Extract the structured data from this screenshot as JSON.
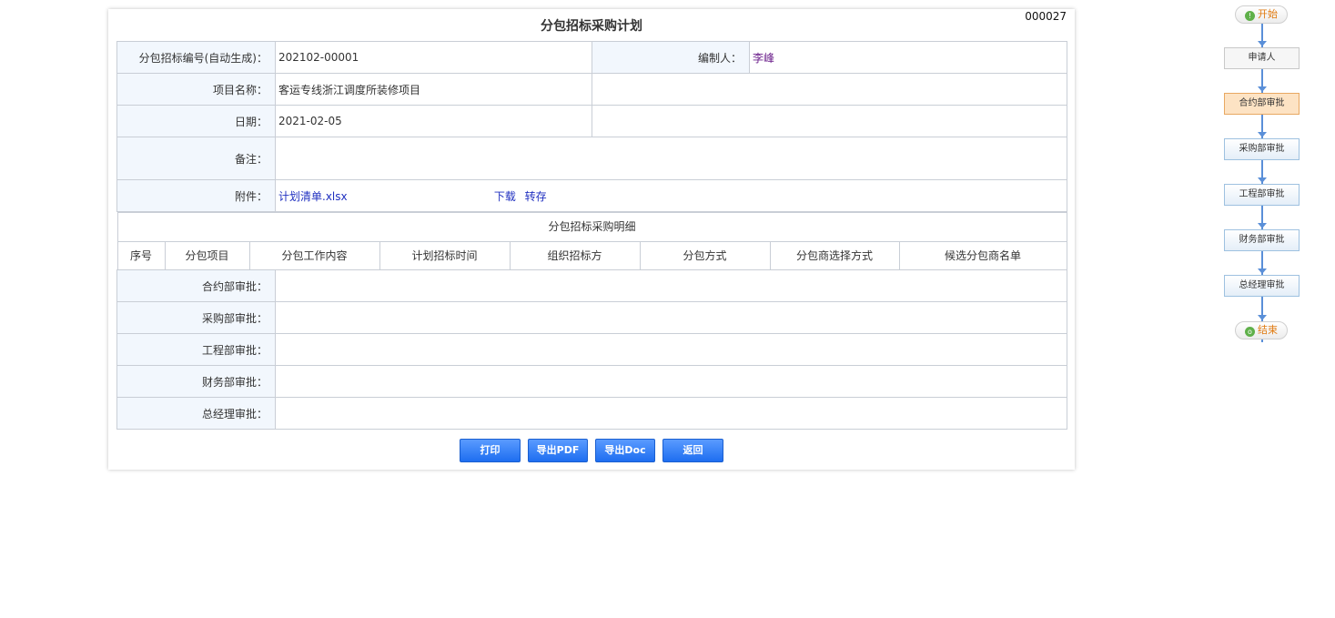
{
  "form": {
    "title": "分包招标采购计划",
    "doc_no": "000027",
    "rows": {
      "code": {
        "label": "分包招标编号(自动生成)：",
        "value": "202102-00001"
      },
      "editor": {
        "label": "编制人：",
        "value": "李峰"
      },
      "project": {
        "label": "项目名称：",
        "value": "客运专线浙江调度所装修项目"
      },
      "date": {
        "label": "日期：",
        "value": "2021-02-05"
      },
      "remark": {
        "label": "备注：",
        "value": ""
      },
      "attachment": {
        "label": "附件：",
        "file": "计划清单.xlsx",
        "download": "下载",
        "save_as": "转存"
      }
    },
    "detail": {
      "title": "分包招标采购明细",
      "columns": [
        "序号",
        "分包项目",
        "分包工作内容",
        "计划招标时间",
        "组织招标方",
        "分包方式",
        "分包商选择方式",
        "候选分包商名单"
      ]
    },
    "approvals": [
      {
        "label": "合约部审批：",
        "value": ""
      },
      {
        "label": "采购部审批：",
        "value": ""
      },
      {
        "label": "工程部审批：",
        "value": ""
      },
      {
        "label": "财务部审批：",
        "value": ""
      },
      {
        "label": "总经理审批：",
        "value": ""
      }
    ],
    "buttons": {
      "print": "打印",
      "export_pdf": "导出PDF",
      "export_doc": "导出Doc",
      "back": "返回"
    }
  },
  "flow": {
    "start": "开始",
    "end": "结束",
    "steps": [
      "申请人",
      "合约部审批",
      "采购部审批",
      "工程部审批",
      "财务部审批",
      "总经理审批"
    ],
    "active_step": "合约部审批"
  }
}
